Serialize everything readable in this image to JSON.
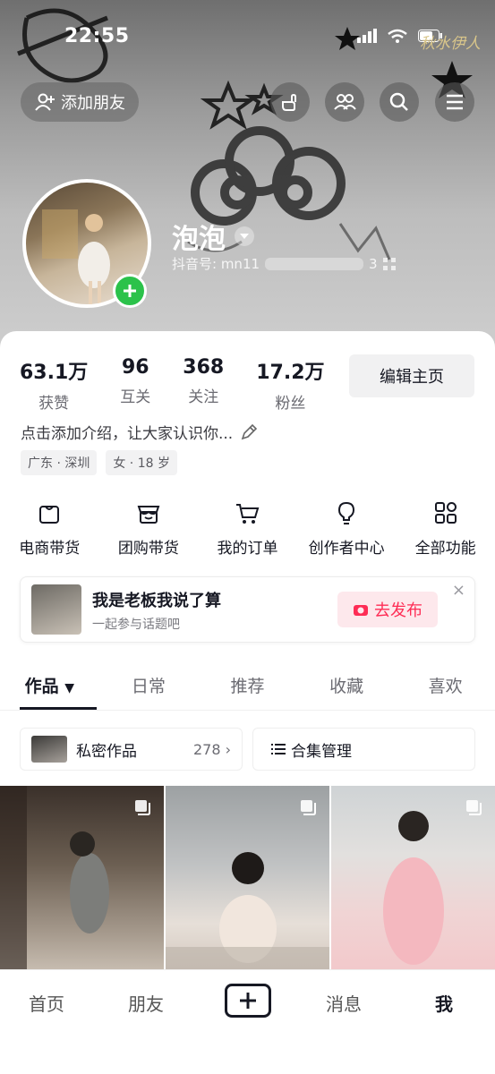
{
  "status_bar": {
    "time": "22:55",
    "watermark": "秋水伊人"
  },
  "header": {
    "add_friend_label": "添加朋友",
    "icons": [
      "gesture-icon",
      "friends-icon",
      "search-icon",
      "menu-icon"
    ]
  },
  "profile": {
    "nickname": "泡泡",
    "douyin_id_label": "抖音号: mn11",
    "id_suffix": "3"
  },
  "stats": [
    {
      "num": "63.1万",
      "label": "获赞"
    },
    {
      "num": "96",
      "label": "互关"
    },
    {
      "num": "368",
      "label": "关注"
    },
    {
      "num": "17.2万",
      "label": "粉丝"
    }
  ],
  "edit_profile_label": "编辑主页",
  "bio": "点击添加介绍，让大家认识你...",
  "tags": [
    "广东 · 深圳",
    "女 · 18 岁"
  ],
  "features": [
    {
      "label": "电商带货",
      "icon": "shopping-bag-icon"
    },
    {
      "label": "团购带货",
      "icon": "store-icon"
    },
    {
      "label": "我的订单",
      "icon": "cart-icon"
    },
    {
      "label": "创作者中心",
      "icon": "bulb-icon"
    },
    {
      "label": "全部功能",
      "icon": "grid-icon"
    }
  ],
  "topic": {
    "title": "我是老板我说了算",
    "subtitle": "一起参与话题吧",
    "publish_label": "去发布",
    "close": "×"
  },
  "tabs": [
    "作品",
    "日常",
    "推荐",
    "收藏",
    "喜欢"
  ],
  "private_works": {
    "label": "私密作品",
    "count": "278"
  },
  "collection": {
    "label": "合集管理"
  },
  "bottom_nav": [
    "首页",
    "朋友",
    "消息",
    "我"
  ],
  "colors": {
    "accent": "#fe2c55",
    "green": "#2bc24a",
    "text": "#161823"
  }
}
